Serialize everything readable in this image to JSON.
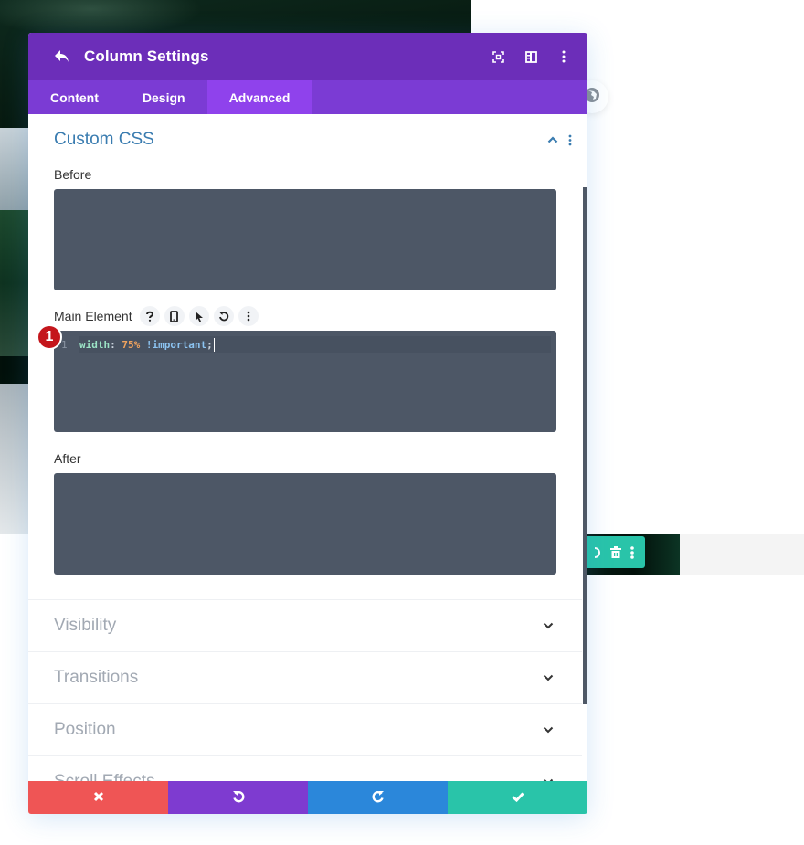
{
  "modal": {
    "title": "Column Settings",
    "header_icons": [
      "back-icon",
      "fullscreen-icon",
      "split-view-icon",
      "kebab-icon"
    ],
    "tabs": [
      {
        "label": "Content",
        "active": false
      },
      {
        "label": "Design",
        "active": false
      },
      {
        "label": "Advanced",
        "active": true
      }
    ]
  },
  "custom_css": {
    "title": "Custom CSS",
    "expanded": true,
    "fields": {
      "before": {
        "label": "Before",
        "value": ""
      },
      "main": {
        "label": "Main Element",
        "code": {
          "line_number": "1",
          "property": "width",
          "colon": ":",
          "value": "75%",
          "important": "!important",
          "semicolon": ";"
        },
        "icons": [
          "help-icon",
          "mobile-icon",
          "hover-pointer-icon",
          "reset-icon",
          "kebab-icon"
        ]
      },
      "after": {
        "label": "After",
        "value": ""
      }
    },
    "badge": "1"
  },
  "sections": [
    {
      "label": "Visibility"
    },
    {
      "label": "Transitions"
    },
    {
      "label": "Position"
    },
    {
      "label": "Scroll Effects"
    }
  ],
  "footer": {
    "buttons": [
      "cancel",
      "undo",
      "redo",
      "save"
    ],
    "colors": {
      "cancel": "#ef5555",
      "undo": "#7e3bd0",
      "redo": "#2b87da",
      "save": "#29c4a9"
    }
  },
  "colors": {
    "header": "#6c2eb9",
    "tabs": "#7b3bd4",
    "tab_active": "#8f42ec",
    "section_title": "#3a7cb0",
    "editor_bg": "#4d5766"
  }
}
